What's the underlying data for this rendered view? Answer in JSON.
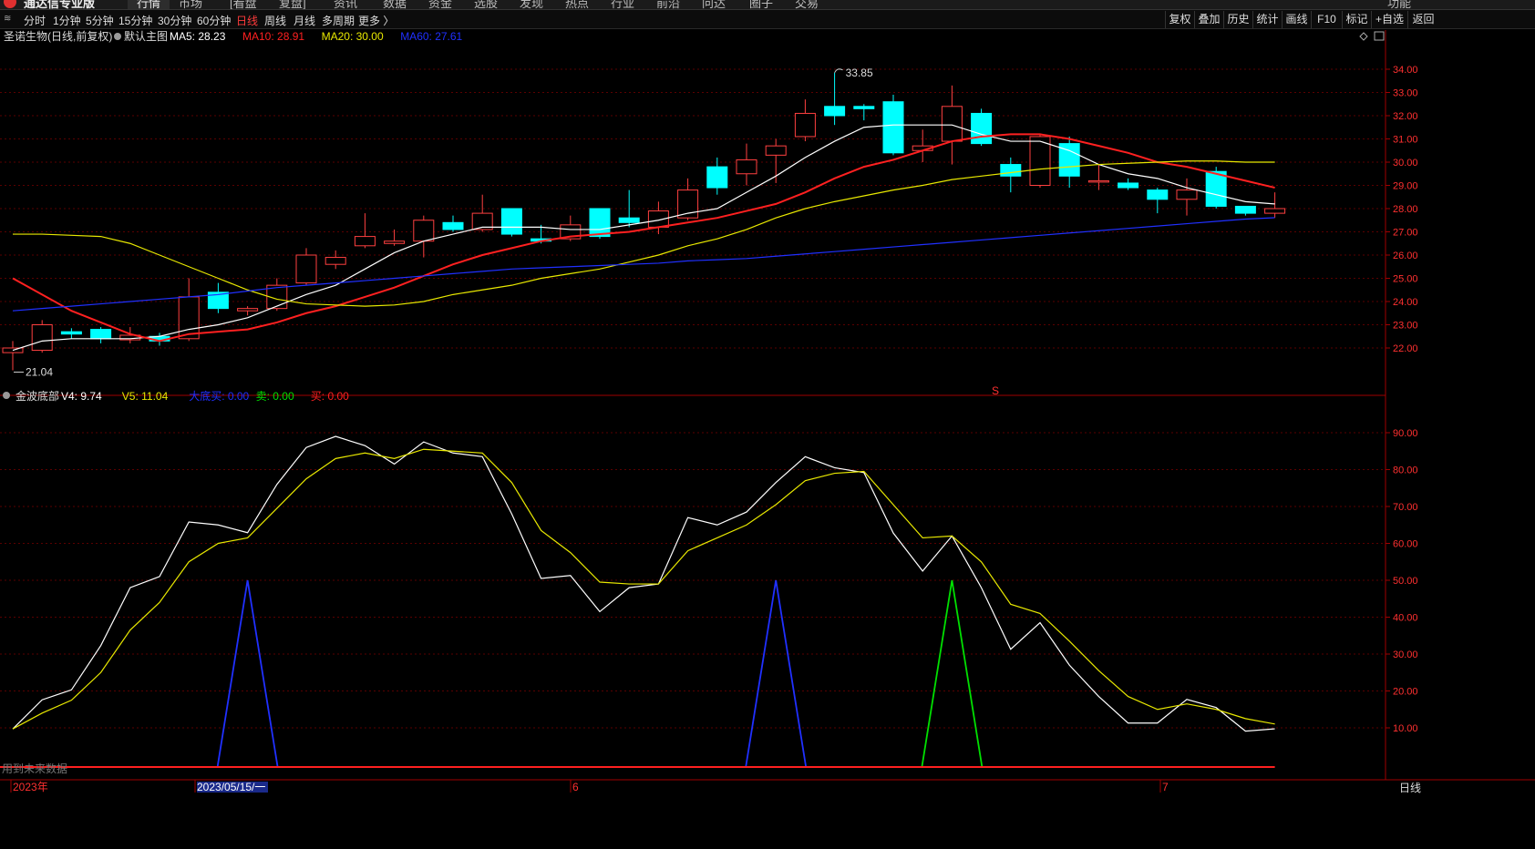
{
  "menu": {
    "app_name": "通达信专业版",
    "items": [
      "行情",
      "市场",
      "[看盘",
      "复盘]",
      "资讯",
      "数据",
      "资金",
      "选股",
      "发现",
      "热点",
      "行业",
      "前沿",
      "问达",
      "圈子",
      "交易"
    ],
    "right": "功能"
  },
  "toolbar": {
    "periods": [
      "分时",
      "1分钟",
      "5分钟",
      "15分钟",
      "30分钟",
      "60分钟",
      "日线",
      "周线",
      "月线",
      "多周期",
      "更多 〉"
    ],
    "active_period": "日线",
    "right_tools": [
      "复权",
      "叠加",
      "历史",
      "统计",
      "画线",
      "F10",
      "标记",
      "+自选",
      "返回"
    ]
  },
  "main_panel": {
    "stock_title": "圣诺生物(日线,前复权)",
    "template_label": "默认主图",
    "ma_labels": [
      {
        "text": "MA5: 28.23",
        "color": "#ffffff"
      },
      {
        "text": "MA10: 28.91",
        "color": "#ff2020"
      },
      {
        "text": "MA20: 30.00",
        "color": "#e8e800"
      },
      {
        "text": "MA60: 27.61",
        "color": "#2030ff"
      }
    ],
    "high_label": "33.85",
    "low_label": "21.04",
    "y_ticks": [
      "34.00",
      "33.00",
      "32.00",
      "31.00",
      "30.00",
      "29.00",
      "28.00",
      "27.00",
      "26.00",
      "25.00",
      "24.00",
      "23.00",
      "22.00"
    ],
    "marker": "S"
  },
  "sub_panel": {
    "indicator_name": "金波底部",
    "labels": [
      {
        "text": "V4: 9.74",
        "color": "#ffffff"
      },
      {
        "text": "V5: 11.04",
        "color": "#e8e800"
      },
      {
        "text": "大底买: 0.00",
        "color": "#2030ff"
      },
      {
        "text": "卖: 0.00",
        "color": "#00e000"
      },
      {
        "text": "买: 0.00",
        "color": "#ff2020"
      }
    ],
    "y_ticks": [
      "90.00",
      "80.00",
      "70.00",
      "60.00",
      "50.00",
      "40.00",
      "30.00",
      "20.00",
      "10.00"
    ],
    "note": "用到未来数据"
  },
  "x_axis": {
    "labels": [
      "2023年",
      "2023/05/15/一",
      "6",
      "7"
    ],
    "right_label": "日线"
  },
  "colors": {
    "up": "#ff4040",
    "down": "#00ffff",
    "ma5": "#ffffff",
    "ma10": "#ff2020",
    "ma20": "#e8e800",
    "ma60": "#2030ff",
    "axis": "#a00000"
  },
  "chart_data": [
    {
      "type": "candlestick",
      "title": "圣诺生物(日线,前复权)",
      "ylim": [
        21.0,
        34.3
      ],
      "candles": [
        {
          "o": 21.8,
          "c": 22.0,
          "h": 22.3,
          "l": 21.04
        },
        {
          "o": 21.9,
          "c": 23.0,
          "h": 23.2,
          "l": 21.8
        },
        {
          "o": 22.7,
          "c": 22.6,
          "h": 22.85,
          "l": 22.4
        },
        {
          "o": 22.8,
          "c": 22.4,
          "h": 22.9,
          "l": 22.2
        },
        {
          "o": 22.35,
          "c": 22.55,
          "h": 22.9,
          "l": 22.2
        },
        {
          "o": 22.5,
          "c": 22.3,
          "h": 22.65,
          "l": 22.1
        },
        {
          "o": 22.4,
          "c": 24.2,
          "h": 25.0,
          "l": 22.3
        },
        {
          "o": 24.4,
          "c": 23.7,
          "h": 24.8,
          "l": 23.5
        },
        {
          "o": 23.6,
          "c": 23.7,
          "h": 23.8,
          "l": 23.4
        },
        {
          "o": 23.7,
          "c": 24.7,
          "h": 25.0,
          "l": 23.6
        },
        {
          "o": 24.8,
          "c": 26.0,
          "h": 26.3,
          "l": 24.7
        },
        {
          "o": 25.6,
          "c": 25.9,
          "h": 26.2,
          "l": 25.4
        },
        {
          "o": 26.4,
          "c": 26.8,
          "h": 27.8,
          "l": 26.3
        },
        {
          "o": 26.5,
          "c": 26.6,
          "h": 27.1,
          "l": 26.4
        },
        {
          "o": 26.6,
          "c": 27.5,
          "h": 27.7,
          "l": 25.9
        },
        {
          "o": 27.4,
          "c": 27.1,
          "h": 27.7,
          "l": 27.0
        },
        {
          "o": 27.1,
          "c": 27.8,
          "h": 28.6,
          "l": 27.0
        },
        {
          "o": 28.0,
          "c": 26.9,
          "h": 28.0,
          "l": 26.8
        },
        {
          "o": 26.7,
          "c": 26.6,
          "h": 27.3,
          "l": 26.5
        },
        {
          "o": 26.7,
          "c": 27.3,
          "h": 27.7,
          "l": 26.6
        },
        {
          "o": 28.0,
          "c": 26.8,
          "h": 28.0,
          "l": 26.7
        },
        {
          "o": 27.6,
          "c": 27.4,
          "h": 28.8,
          "l": 27.2
        },
        {
          "o": 27.2,
          "c": 27.9,
          "h": 28.3,
          "l": 26.9
        },
        {
          "o": 27.6,
          "c": 28.8,
          "h": 29.3,
          "l": 27.5
        },
        {
          "o": 29.8,
          "c": 28.9,
          "h": 30.2,
          "l": 28.6
        },
        {
          "o": 29.5,
          "c": 30.1,
          "h": 30.8,
          "l": 29.0
        },
        {
          "o": 30.3,
          "c": 30.7,
          "h": 31.0,
          "l": 29.1
        },
        {
          "o": 31.1,
          "c": 32.1,
          "h": 32.7,
          "l": 30.9
        },
        {
          "o": 32.4,
          "c": 32.0,
          "h": 33.85,
          "l": 31.6
        },
        {
          "o": 32.4,
          "c": 32.3,
          "h": 32.5,
          "l": 31.8
        },
        {
          "o": 32.6,
          "c": 30.4,
          "h": 32.9,
          "l": 30.3
        },
        {
          "o": 30.5,
          "c": 30.7,
          "h": 31.4,
          "l": 30.0
        },
        {
          "o": 30.9,
          "c": 32.4,
          "h": 33.3,
          "l": 29.9
        },
        {
          "o": 32.1,
          "c": 30.8,
          "h": 32.3,
          "l": 30.7
        },
        {
          "o": 29.9,
          "c": 29.4,
          "h": 30.2,
          "l": 28.7
        },
        {
          "o": 29.0,
          "c": 31.1,
          "h": 31.2,
          "l": 28.9
        },
        {
          "o": 30.8,
          "c": 29.4,
          "h": 31.1,
          "l": 28.9
        },
        {
          "o": 29.2,
          "c": 29.2,
          "h": 29.9,
          "l": 28.8
        },
        {
          "o": 29.1,
          "c": 28.9,
          "h": 29.3,
          "l": 28.8
        },
        {
          "o": 28.8,
          "c": 28.4,
          "h": 28.9,
          "l": 27.8
        },
        {
          "o": 28.4,
          "c": 28.8,
          "h": 29.3,
          "l": 27.7
        },
        {
          "o": 29.6,
          "c": 28.1,
          "h": 29.8,
          "l": 28.0
        },
        {
          "o": 28.1,
          "c": 27.8,
          "h": 28.1,
          "l": 27.7
        },
        {
          "o": 27.8,
          "c": 28.0,
          "h": 28.7,
          "l": 27.6
        }
      ],
      "series": [
        {
          "name": "MA5",
          "values": [
            21.9,
            22.3,
            22.4,
            22.4,
            22.4,
            22.5,
            22.8,
            23.0,
            23.3,
            23.8,
            24.3,
            24.7,
            25.4,
            26.1,
            26.6,
            26.9,
            27.2,
            27.2,
            27.2,
            27.1,
            27.1,
            27.3,
            27.5,
            27.8,
            28.0,
            28.7,
            29.4,
            30.2,
            30.9,
            31.5,
            31.6,
            31.6,
            31.6,
            31.2,
            30.9,
            30.9,
            30.5,
            29.9,
            29.5,
            29.3,
            28.9,
            28.6,
            28.3,
            28.2
          ]
        },
        {
          "name": "MA10",
          "values": [
            25.0,
            24.3,
            23.6,
            23.1,
            22.6,
            22.3,
            22.6,
            22.7,
            22.8,
            23.1,
            23.5,
            23.8,
            24.2,
            24.6,
            25.1,
            25.6,
            26.0,
            26.3,
            26.6,
            26.8,
            26.9,
            27.0,
            27.2,
            27.4,
            27.6,
            27.9,
            28.2,
            28.7,
            29.3,
            29.8,
            30.1,
            30.5,
            30.9,
            31.1,
            31.2,
            31.2,
            31.0,
            30.7,
            30.4,
            30.0,
            29.8,
            29.5,
            29.2,
            28.9
          ]
        },
        {
          "name": "MA20",
          "values": [
            26.9,
            26.9,
            26.85,
            26.8,
            26.5,
            26.0,
            25.5,
            25.0,
            24.5,
            24.1,
            23.9,
            23.85,
            23.8,
            23.85,
            24.0,
            24.3,
            24.5,
            24.7,
            25.0,
            25.2,
            25.4,
            25.7,
            26.0,
            26.4,
            26.7,
            27.1,
            27.6,
            28.0,
            28.3,
            28.55,
            28.8,
            29.0,
            29.25,
            29.4,
            29.55,
            29.7,
            29.8,
            29.9,
            29.95,
            30.0,
            30.05,
            30.05,
            30.0,
            30.0
          ]
        },
        {
          "name": "MA60",
          "values": [
            23.6,
            23.7,
            23.8,
            23.9,
            24.0,
            24.1,
            24.2,
            24.3,
            24.45,
            24.6,
            24.7,
            24.8,
            24.9,
            25.0,
            25.1,
            25.2,
            25.3,
            25.4,
            25.45,
            25.5,
            25.55,
            25.6,
            25.65,
            25.75,
            25.8,
            25.85,
            25.95,
            26.05,
            26.15,
            26.25,
            26.35,
            26.45,
            26.55,
            26.65,
            26.75,
            26.85,
            26.95,
            27.05,
            27.15,
            27.25,
            27.35,
            27.45,
            27.55,
            27.61
          ]
        }
      ]
    },
    {
      "type": "line",
      "title": "金波底部",
      "ylim": [
        0,
        94
      ],
      "series": [
        {
          "name": "V4",
          "values": [
            9.7,
            17.6,
            20.3,
            32.3,
            48.0,
            51.0,
            65.8,
            65.0,
            62.9,
            76.0,
            86.0,
            89.0,
            86.5,
            81.5,
            87.5,
            84.5,
            83.5,
            68.0,
            50.5,
            51.3,
            41.5,
            48.0,
            49.0,
            67.0,
            65.0,
            68.5,
            76.5,
            83.5,
            80.5,
            79.2,
            62.8,
            52.5,
            62.0,
            48.0,
            31.3,
            38.5,
            27.0,
            18.5,
            11.3,
            11.3,
            17.7,
            15.5,
            9.1,
            9.74
          ]
        },
        {
          "name": "V5",
          "values": [
            9.7,
            14.0,
            17.5,
            25.0,
            36.5,
            44.0,
            55.0,
            60.0,
            61.5,
            69.5,
            77.5,
            83.0,
            84.5,
            83.0,
            85.5,
            85.0,
            84.5,
            76.5,
            63.5,
            57.5,
            49.5,
            49.0,
            49.0,
            58.0,
            61.5,
            65.0,
            70.5,
            77.0,
            79.0,
            79.5,
            70.5,
            61.5,
            62.0,
            55.0,
            43.5,
            41.0,
            33.5,
            25.5,
            18.5,
            15.0,
            16.5,
            15.0,
            12.5,
            11.04
          ]
        },
        {
          "name": "大底买",
          "values": [
            0,
            0,
            0,
            0,
            0,
            0,
            0,
            0,
            50,
            0,
            0,
            0,
            0,
            0,
            0,
            0,
            0,
            0,
            0,
            0,
            0,
            0,
            0,
            0,
            0,
            0,
            50,
            0,
            0,
            0,
            0,
            0,
            0,
            0,
            0,
            0,
            0,
            0,
            0,
            0,
            0,
            0,
            0,
            0
          ]
        },
        {
          "name": "卖",
          "values": [
            0,
            0,
            0,
            0,
            0,
            0,
            0,
            0,
            0,
            0,
            0,
            0,
            0,
            0,
            0,
            0,
            0,
            0,
            0,
            0,
            0,
            0,
            0,
            0,
            0,
            0,
            0,
            0,
            0,
            0,
            0,
            0,
            50,
            0,
            0,
            0,
            0,
            0,
            0,
            0,
            0,
            0,
            0,
            0
          ]
        },
        {
          "name": "买",
          "values": [
            0,
            0,
            0,
            0,
            0,
            0,
            0,
            0,
            0,
            0,
            0,
            0,
            0,
            0,
            0,
            0,
            0,
            0,
            0,
            0,
            0,
            0,
            0,
            0,
            0,
            0,
            0,
            0,
            0,
            0,
            0,
            0,
            0,
            0,
            0,
            0,
            0,
            0,
            0,
            0,
            0,
            0,
            0,
            0
          ]
        }
      ]
    }
  ]
}
